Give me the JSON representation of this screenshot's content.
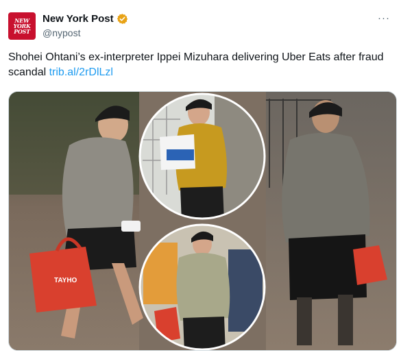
{
  "account": {
    "display_name": "New York Post",
    "handle": "@nypost",
    "logo_lines": [
      "NEW",
      "YORK",
      "POST"
    ],
    "verified_color": "#e8a317"
  },
  "menu": {
    "more_label": "···"
  },
  "tweet": {
    "text": "Shohei Ohtani’s ex-interpreter Ippei Mizuhara delivering Uber Eats after fraud scandal ",
    "link": "trib.al/2rDlLzl"
  },
  "media": {
    "bag_text": "TAYHO",
    "description_icon": "photo-collage"
  },
  "colors": {
    "link": "#1d9bf0",
    "brand": "#c8102e",
    "text": "#0f1419",
    "muted": "#536471"
  }
}
